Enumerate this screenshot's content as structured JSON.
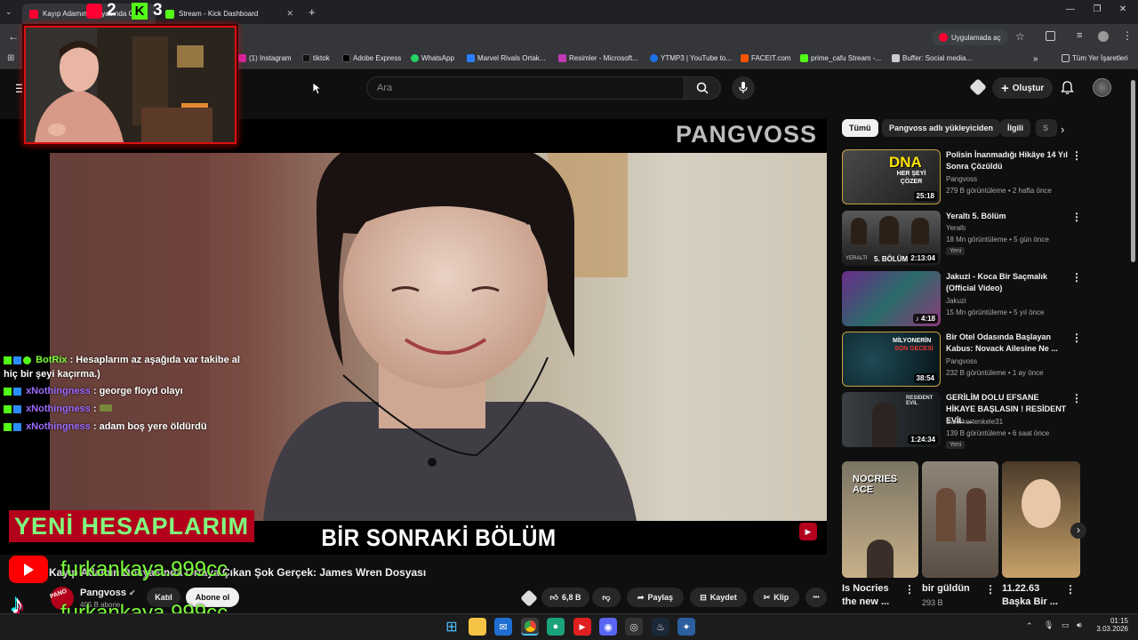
{
  "browser": {
    "tabs": [
      {
        "label": "Kayıp Adamın Dosyasında Ortaya Ç"
      },
      {
        "label": "Stream - Kick Dashboard"
      }
    ],
    "new_tab": "+",
    "open_in_app": "Uygulamada aç",
    "bookmarks": [
      "(1) Instagram",
      "tiktok",
      "Adobe Express",
      "WhatsApp",
      "Marvel Rivals Ortak...",
      "Resimler - Microsoft...",
      "YTMP3 | YouTube to...",
      "FACEIT.com",
      "prime_cafu Stream -...",
      "Buffer: Social media..."
    ],
    "bookmarks_more": "»",
    "all_bookmarks": "Tüm Yer İşaretleri"
  },
  "header": {
    "search_placeholder": "Ara",
    "create_label": "Oluştur"
  },
  "video": {
    "brand": "PANGVOSS",
    "subtitle": "BİR SONRAKİ BÖLÜM",
    "title": "Kayıp Adamın Dosyasında Ortaya Çıkan Şok Gerçek: James Wren Dosyası",
    "channel": "Pangvoss",
    "subs": "405 B abone",
    "join": "Katıl",
    "subscribe": "Abone ol",
    "likes": "6,8 B",
    "share": "Paylaş",
    "save": "Kaydet",
    "clip": "Klip",
    "more": "•••"
  },
  "overlay": {
    "counts": [
      "2",
      "3"
    ],
    "chat": [
      {
        "user": "BotRix",
        "msg": ": Hesaplarım az aşağıda var takibe al",
        "cont": "hiç bir şeyi kaçırma.)"
      },
      {
        "user": "xNothingness",
        "msg": ": george floyd olayı"
      },
      {
        "user": "xNothingness",
        "msg": ":"
      },
      {
        "user": "xNothingness",
        "msg": ": adam boş yere öldürdü"
      }
    ],
    "banner": "YENİ HESAPLARIM",
    "youtube_handle": "furkankaya.999cc",
    "tiktok_handle": "furkankaya.999cc",
    "pano": "PANO"
  },
  "sidebar": {
    "chips": [
      "Tümü",
      "Pangvoss adlı yükleyiciden",
      "İlgili",
      "S"
    ],
    "recs": [
      {
        "title": "Polisin İnanmadığı Hikâye 14 Yıl Sonra Çözüldü",
        "channel": "Pangvoss",
        "meta": "279 B görüntüleme • 2 hafta önce",
        "dur": "25:18",
        "thumb_text": "DNA",
        "thumb_sub": "HER ŞEYİ ÇÖZER"
      },
      {
        "title": "Yeraltı 5. Bölüm",
        "channel": "Yeraltı",
        "meta": "18 Mn görüntüleme • 5 gün önce",
        "badge": "Yeni",
        "dur": "2:13:04",
        "thumb_text": "5. BÖLÜM",
        "thumb_sub": "YERALTI"
      },
      {
        "title": "Jakuzi - Koca Bir Saçmalık (Official Video)",
        "channel": "Jakuzi",
        "meta": "15 Mn görüntüleme • 5 yıl önce",
        "dur": "♪ 4:18"
      },
      {
        "title": "Bir Otel Odasında Başlayan Kabus: Novack Ailesine Ne ...",
        "channel": "Pangvoss",
        "meta": "232 B görüntüleme • 1 ay önce",
        "dur": "38:54",
        "thumb_text": "MİLYONERİN",
        "thumb_sub": "SON GECESİ"
      },
      {
        "title": "GERİLİM DOLU EFSANE HİKAYE BAŞLASIN ! RESİDENT EVİL ...",
        "channel": "Bakirkertenkele31",
        "meta": "139 B görüntüleme • 6 saat önce",
        "badge": "Yeni",
        "dur": "1:24:34",
        "thumb_text": "RESIDENT EVIL"
      }
    ],
    "shorts": [
      {
        "title": "Is Nocries",
        "title2": "the new ...",
        "thumb_text": "NOCRIES ACE"
      },
      {
        "title": "bir güldün",
        "meta": "293 B"
      },
      {
        "title": "11.22.63",
        "title2": "Başka Bir ..."
      }
    ]
  },
  "taskbar": {
    "time": "01:15",
    "date": "3.03.2026"
  },
  "colors": {
    "yt_red": "#ff0033",
    "kick_green": "#53fc18",
    "chat_user": "#9d6bff",
    "banner_bg": "#b3001b"
  }
}
